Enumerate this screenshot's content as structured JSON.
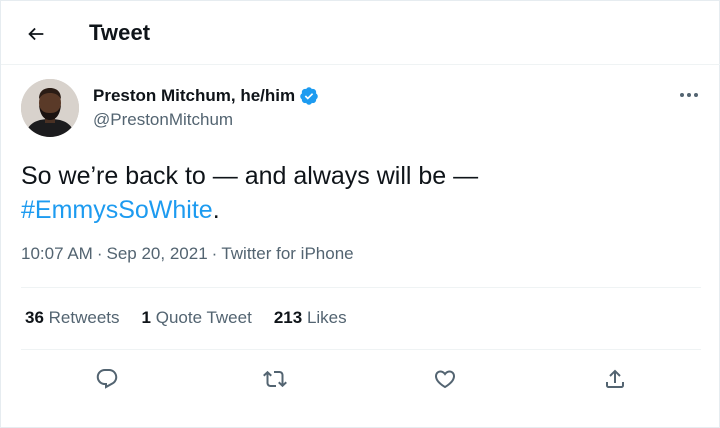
{
  "header": {
    "title": "Tweet",
    "back_icon": "arrow-left-icon"
  },
  "author": {
    "name": "Preston Mitchum, he/him",
    "handle": "@PrestonMitchum",
    "verified_icon": "verified-badge-icon",
    "verified_color": "#1d9bf0"
  },
  "tweet": {
    "text_before": "So we’re back to — and always will be —",
    "hashtag": "#EmmysSoWhite",
    "text_after": ".",
    "time": "10:07 AM",
    "sep1": "·",
    "date": "Sep 20, 2021",
    "sep2": "·",
    "source": "Twitter for iPhone"
  },
  "stats": {
    "retweets_count": "36",
    "retweets_label": "Retweets",
    "quotes_count": "1",
    "quotes_label": "Quote Tweet",
    "likes_count": "213",
    "likes_label": "Likes"
  },
  "actions": [
    "reply-icon",
    "retweet-icon",
    "like-icon",
    "share-icon"
  ],
  "colors": {
    "accent": "#1d9bf0",
    "text": "#0f1419",
    "secondary": "#536471",
    "border": "#eff3f4"
  }
}
